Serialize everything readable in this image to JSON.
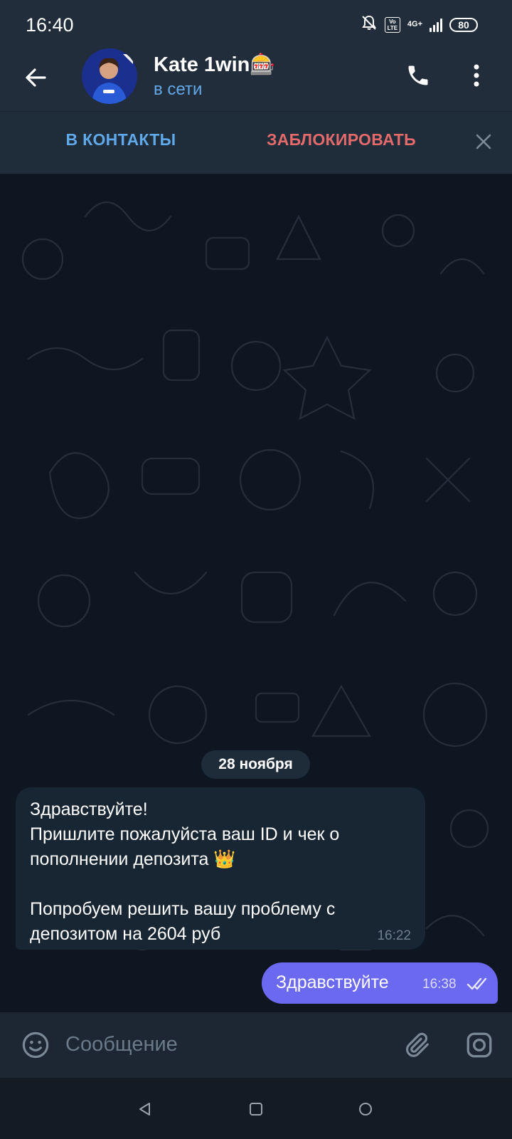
{
  "status_bar": {
    "time": "16:40",
    "network": "4G+",
    "volte": "Vo LTE",
    "battery": "80"
  },
  "header": {
    "back_icon": "arrow-left-icon",
    "chat_title": "Kate 1win🎰",
    "chat_status": "в сети",
    "call_icon": "phone-icon",
    "menu_icon": "more-vertical-icon"
  },
  "action_bar": {
    "add_contact_label": "В КОНТАКТЫ",
    "block_label": "ЗАБЛОКИРОВАТЬ",
    "close_icon": "close-icon"
  },
  "chat": {
    "date_separator": "28 ноября",
    "messages": [
      {
        "direction": "incoming",
        "text": "Здравствуйте!\nПришлите пожалуйста ваш  ID  и чек о пополнении депозита 👑\n\nПопробуем решить вашу проблему с депозитом на 2604 руб",
        "time": "16:22"
      },
      {
        "direction": "outgoing",
        "text": "Здравствуйте",
        "time": "16:38",
        "status": "read"
      }
    ]
  },
  "composer": {
    "placeholder": "Сообщение",
    "emoji_icon": "emoji-icon",
    "attach_icon": "paperclip-icon",
    "camera_icon": "camera-icon"
  },
  "colors": {
    "header_bg": "#212d3b",
    "chat_bg": "#0e1621",
    "incoming_bubble": "#182533",
    "outgoing_bubble": "#6b69f0",
    "accent_blue": "#5fa9ea",
    "danger_red": "#e26a6a"
  }
}
